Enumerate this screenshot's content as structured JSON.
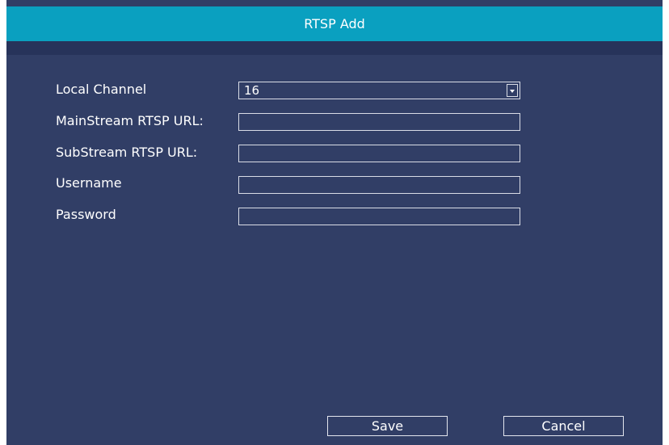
{
  "dialog": {
    "title": "RTSP Add"
  },
  "form": {
    "local_channel": {
      "label": "Local Channel",
      "value": "16"
    },
    "mainstream_url": {
      "label": "MainStream RTSP URL:",
      "value": ""
    },
    "substream_url": {
      "label": "SubStream RTSP URL:",
      "value": ""
    },
    "username": {
      "label": "Username",
      "value": ""
    },
    "password": {
      "label": "Password",
      "value": ""
    }
  },
  "buttons": {
    "save_label": "Save",
    "cancel_label": "Cancel"
  },
  "icons": {
    "dropdown": "chevron-down-icon"
  },
  "colors": {
    "title_bar": "#0aa0c0",
    "dialog_background": "#313e66",
    "border": "#d9dce6",
    "text": "#ffffff"
  }
}
